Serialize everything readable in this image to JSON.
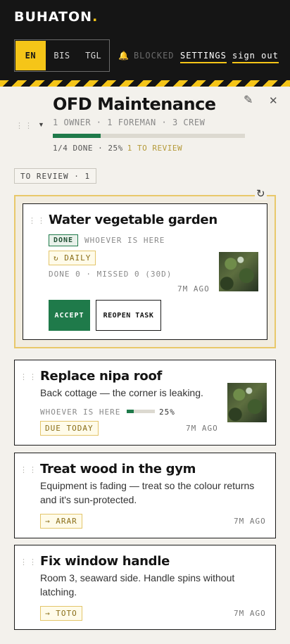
{
  "header": {
    "brand": "BUHATON",
    "brand_dot": ".",
    "languages": [
      {
        "label": "EN",
        "active": true
      },
      {
        "label": "BIS",
        "active": false
      },
      {
        "label": "TGL",
        "active": false
      }
    ],
    "blocked_label": "BLOCKED",
    "settings_label": "SETTINGS",
    "signout_label": "sign out"
  },
  "project": {
    "title": "OFD Maintenance",
    "members": "1 OWNER · 1 FOREMAN · 3 CREW",
    "progress_fraction": 0.25,
    "progress_text": "1/4 DONE · 25%",
    "review_text": "1 TO REVIEW"
  },
  "filter": {
    "label": "TO REVIEW · 1"
  },
  "review_task": {
    "title": "Water vegetable garden",
    "status": "DONE",
    "assignee": "WHOEVER IS HERE",
    "recurrence": "↻ DAILY",
    "stats": "DONE 0 · MISSED 0 (30D)",
    "time": "7M AGO",
    "accept_label": "ACCEPT",
    "reopen_label": "REOPEN TASK"
  },
  "tasks": [
    {
      "title": "Replace nipa roof",
      "desc_lines": [
        "Back cottage — the corner is leaking."
      ],
      "assignee": "WHOEVER IS HERE",
      "progress_fraction": 0.25,
      "progress_text": "25%",
      "tag": "DUE TODAY",
      "time": "7M AGO"
    },
    {
      "title": "Treat wood in the gym",
      "desc_lines": [
        "Equipment is fading — treat so the colour returns",
        "and it's sun-protected."
      ],
      "tag": "→ ARAR",
      "time": "7M AGO"
    },
    {
      "title": "Fix window handle",
      "desc_lines": [
        "Room 3, seaward side. Handle spins without",
        "latching."
      ],
      "tag": "→ TOTO",
      "time": "7M AGO"
    }
  ],
  "colors": {
    "accent": "#f5c518",
    "success": "#1f7a4a",
    "review_border": "#e8c86a"
  }
}
